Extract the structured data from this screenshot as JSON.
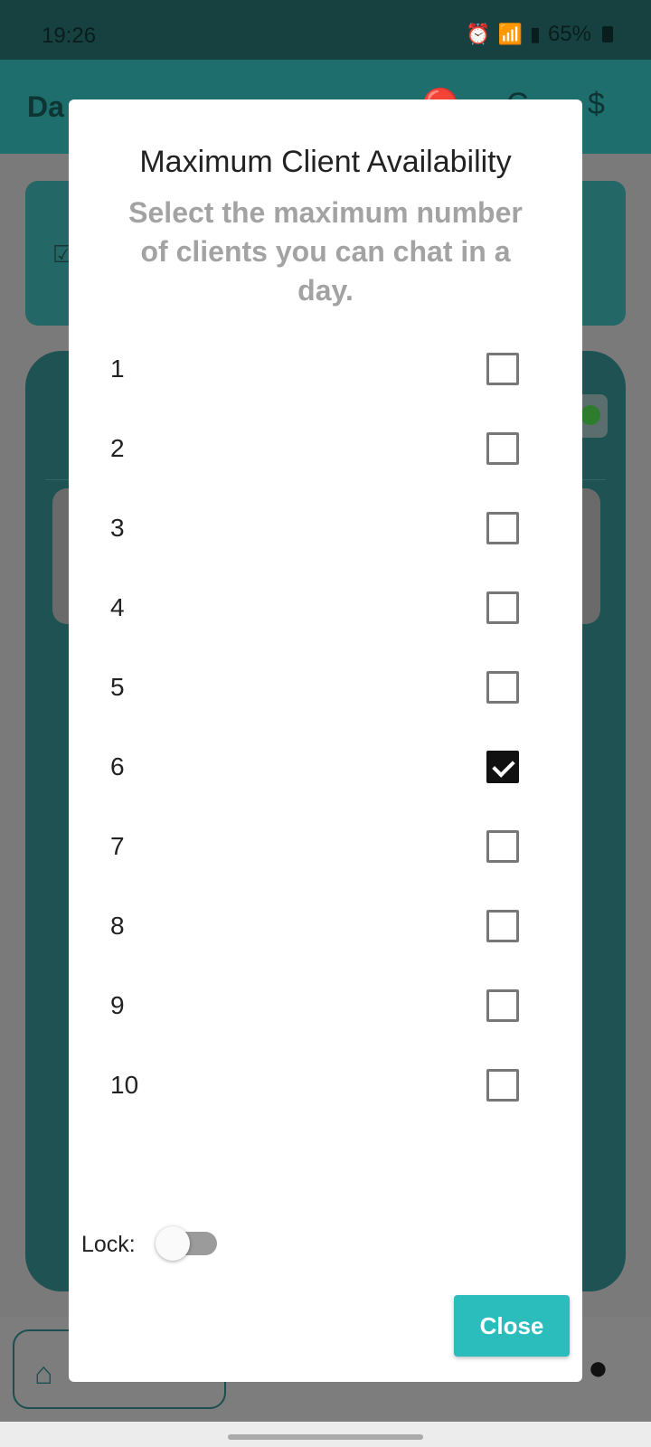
{
  "status_bar": {
    "time": "19:26",
    "battery": "65%",
    "icons": [
      "alarm-icon",
      "wifi-icon",
      "signal-icon",
      "battery-icon"
    ]
  },
  "app_bar": {
    "title": "Da",
    "icons": [
      "no-cart-icon",
      "c-plus-icon",
      "dollar-icon"
    ]
  },
  "dialog": {
    "title": "Maximum Client Availability",
    "subtitle": "Select the maximum number of clients you can chat in a day.",
    "options": [
      {
        "label": "1",
        "checked": false
      },
      {
        "label": "2",
        "checked": false
      },
      {
        "label": "3",
        "checked": false
      },
      {
        "label": "4",
        "checked": false
      },
      {
        "label": "5",
        "checked": false
      },
      {
        "label": "6",
        "checked": true
      },
      {
        "label": "7",
        "checked": false
      },
      {
        "label": "8",
        "checked": false
      },
      {
        "label": "9",
        "checked": false
      },
      {
        "label": "10",
        "checked": false
      }
    ],
    "lock_label": "Lock:",
    "lock_on": false,
    "close_label": "Close"
  },
  "colors": {
    "accent": "#2bbcbc",
    "app_bar": "#1f6e6e",
    "status_bar": "#174141"
  }
}
